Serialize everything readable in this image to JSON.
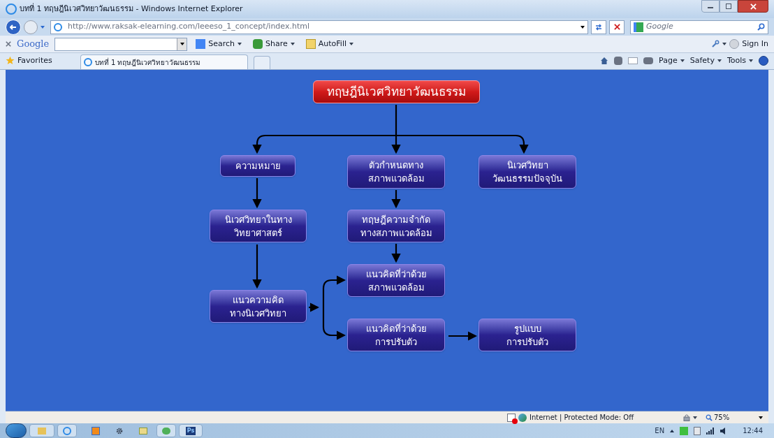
{
  "window": {
    "title": "บทที่ 1 ทฤษฎีนิเวศวิทยาวัฒนธรรม - Windows Internet Explorer"
  },
  "address_bar": {
    "url": "http://www.raksak-elearning.com/leeeso_1_concept/index.html"
  },
  "search_box": {
    "placeholder": "Google"
  },
  "google_toolbar": {
    "logo": "Google",
    "buttons": [
      "Search",
      "Share",
      "AutoFill"
    ],
    "sign_in": "Sign In"
  },
  "favorites_bar": {
    "favorites": "Favorites",
    "tabs": [
      {
        "label": "บทที่ 1 ทฤษฎีนิเวศวิทยาวัฒนธรรม",
        "selected": true
      }
    ]
  },
  "command_bar": {
    "menus": [
      "Page",
      "Safety",
      "Tools"
    ]
  },
  "diagram": {
    "title": "ทฤษฎีนิเวศวิทยาวัฒนธรรม",
    "nodes": [
      {
        "lines": [
          "ความหมาย"
        ]
      },
      {
        "lines": [
          "ตัวกำหนดทาง",
          "สภาพแวดล้อม"
        ]
      },
      {
        "lines": [
          "นิเวศวิทยา",
          "วัฒนธรรมปัจจุบัน"
        ]
      },
      {
        "lines": [
          "นิเวศวิทยาในทาง",
          "วิทยาศาสตร์"
        ]
      },
      {
        "lines": [
          "ทฤษฎีความจำกัด",
          "ทางสภาพแวดล้อม"
        ]
      },
      {
        "lines": [
          "แนวคิดที่ว่าด้วย",
          "สภาพแวดล้อม"
        ]
      },
      {
        "lines": [
          "แนวความคิด",
          "ทางนิเวศวิทยา"
        ]
      },
      {
        "lines": [
          "แนวคิดที่ว่าด้วย",
          "การปรับตัว"
        ]
      },
      {
        "lines": [
          "รูปแบบ",
          "การปรับตัว"
        ]
      }
    ]
  },
  "status_bar": {
    "zone": "Internet | Protected Mode: Off",
    "zoom": "75%"
  },
  "taskbar": {
    "app_label": "Ps",
    "language": "EN",
    "clock": "12:44"
  }
}
